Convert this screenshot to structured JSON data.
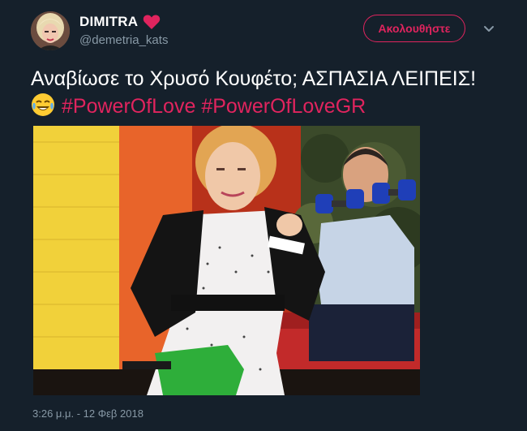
{
  "author": {
    "display_name": "DIMITRA",
    "handle": "@demetria_kats",
    "verified_badge_icon": "red-heart-icon"
  },
  "actions": {
    "follow_label": "Ακολουθήστε",
    "more_icon": "chevron-down-icon"
  },
  "tweet": {
    "text_part1": "Αναβίωσε το Χρυσό Κουφέτο; ΑΣΠΑΣΙΑ ΛΕΙΠΕΙΣ!",
    "emoji_icon": "face-with-tears-of-joy-icon",
    "hashtags": [
      "#PowerOfLove",
      "#PowerOfLoveGR"
    ],
    "timestamp": "3:26 μ.μ. - 12 Φεβ 2018"
  },
  "colors": {
    "background": "#15202b",
    "accent": "#e0245e",
    "secondary_text": "#8899a6"
  }
}
